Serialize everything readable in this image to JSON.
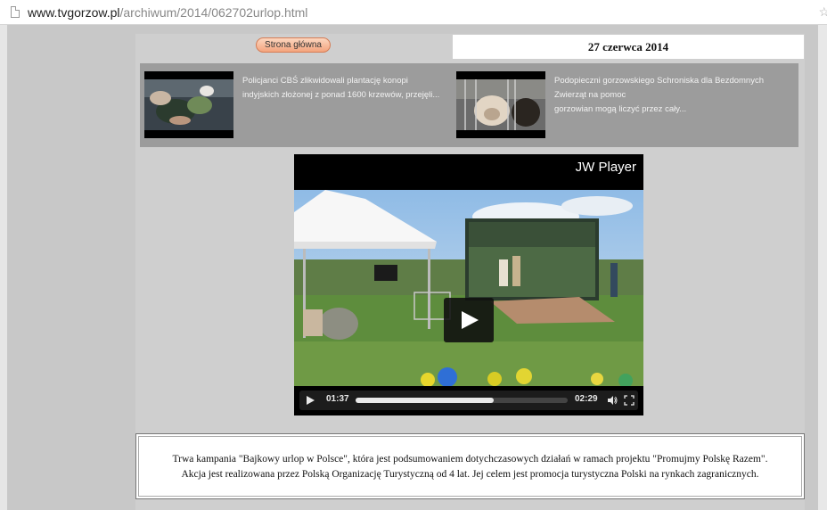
{
  "browser": {
    "url_domain": "www.tvgorzow.pl",
    "url_path": "/archiwum/2014/062702urlop.html"
  },
  "header": {
    "home_button": "Strona główna",
    "date": "27 czerwca 2014"
  },
  "news": [
    {
      "lines": [
        "Policjanci CBŚ zlikwidowali plantację konopi",
        "indyjskich złożonej z ponad 1600 krzewów, przejęli..."
      ]
    },
    {
      "lines": [
        "Podopieczni gorzowskiego Schroniska dla Bezdomnych",
        "Zwierząt na pomoc",
        "gorzowian mogą liczyć przez cały..."
      ]
    }
  ],
  "player": {
    "brand": "JW Player",
    "current_time": "01:37",
    "duration": "02:29",
    "progress_fraction": 0.65
  },
  "description": {
    "line1": "Trwa kampania \"Bajkowy urlop w Polsce\", która jest podsumowaniem dotychczasowych działań w ramach projektu \"Promujmy Polskę Razem\".",
    "line2": "Akcja jest realizowana przez Polską Organizację Turystyczną od 4 lat. Jej celem jest promocja turystyczna Polski na rynkach zagranicznych."
  },
  "colors": {
    "page_bg": "#c8c8c8",
    "news_strip_bg": "#9c9c9c",
    "home_button": "#f4a47e"
  }
}
